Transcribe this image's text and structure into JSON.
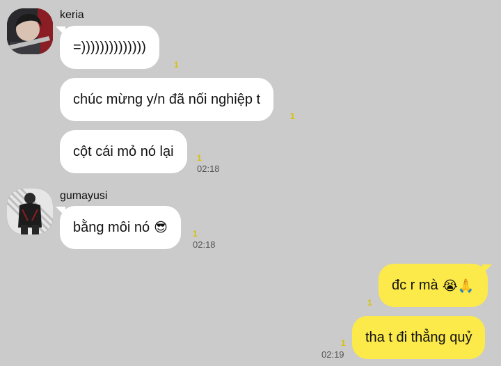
{
  "messages": {
    "keria": {
      "sender": "keria",
      "m1": "=))))))))))))))",
      "m1_unread": "1",
      "m2": "chúc mừng y/n đã nối nghiệp t",
      "m2_unread": "1",
      "m3": "cột cái mỏ nó lại",
      "m3_unread": "1",
      "m3_time": "02:18"
    },
    "gumayusi": {
      "sender": "gumayusi",
      "m1": "bằng môi nó",
      "m1_emoji": "😎",
      "m1_unread": "1",
      "m1_time": "02:18"
    },
    "me": {
      "m1": "đc r mà",
      "m1_emoji": "😭🙏",
      "m1_unread": "1",
      "m2": "tha t đi thẳng quỷ",
      "m2_unread": "1",
      "m2_time": "02:19"
    }
  },
  "colors": {
    "background": "#cbcbcb",
    "incoming_bubble": "#ffffff",
    "outgoing_bubble": "#fce94a",
    "unread_count": "#d8c200"
  }
}
